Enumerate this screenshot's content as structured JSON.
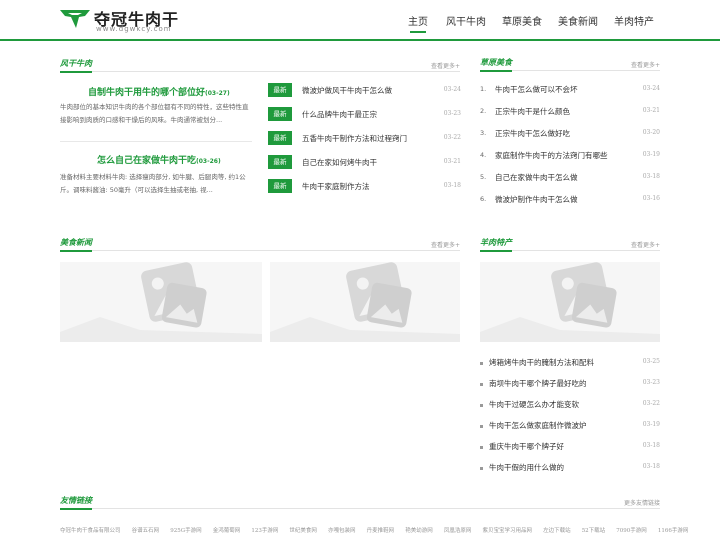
{
  "header": {
    "logo_title": "夺冠牛肉干",
    "logo_sub": "www.dgwkcy.com",
    "nav": [
      "主页",
      "风干牛肉",
      "草原美食",
      "美食新闻",
      "羊肉特产"
    ]
  },
  "sections": {
    "s1_title": "风干牛肉",
    "s1_more": "查看更多+",
    "s2_title": "草原美食",
    "s2_more": "查看更多+",
    "s3_title": "美食新闻",
    "s3_more": "查看更多+",
    "s4_title": "羊肉特产",
    "s4_more": "查看更多+",
    "s5_title": "友情链接",
    "s5_more": "更多友情链接"
  },
  "featured": [
    {
      "title": "自制牛肉干用牛的哪个部位好",
      "date": "(03-27)",
      "desc": "牛肉部位的基本知识牛肉的各个部位都有不同的特性，这些特性直接影响到肉质的口感和干燥后的风味。牛肉通常被划分..."
    },
    {
      "title": "怎么自己在家做牛肉干吃",
      "date": "(03-26)",
      "desc": "准备材料主要材料牛肉: 选择瘦肉部分, 如牛腱、后腿肉等, 约1公斤。调味料酱油: 50毫升（可以选择生抽或老抽, 视..."
    }
  ],
  "badge_label": "最新",
  "latest": [
    {
      "title": "微波炉做风干牛肉干怎么做",
      "date": "03-24"
    },
    {
      "title": "什么品牌牛肉干最正宗",
      "date": "03-23"
    },
    {
      "title": "五香牛肉干制作方法和过程窍门",
      "date": "03-22"
    },
    {
      "title": "自己在家如何烤牛肉干",
      "date": "03-21"
    },
    {
      "title": "牛肉干家庭制作方法",
      "date": "03-18"
    }
  ],
  "grassland": [
    {
      "num": "1.",
      "title": "牛肉干怎么做可以不会坏",
      "date": "03-24"
    },
    {
      "num": "2.",
      "title": "正宗牛肉干是什么颜色",
      "date": "03-21"
    },
    {
      "num": "3.",
      "title": "正宗牛肉干怎么做好吃",
      "date": "03-20"
    },
    {
      "num": "4.",
      "title": "家庭制作牛肉干的方法窍门有哪些",
      "date": "03-19"
    },
    {
      "num": "5.",
      "title": "自己在家做牛肉干怎么做",
      "date": "03-18"
    },
    {
      "num": "6.",
      "title": "微波炉制作牛肉干怎么做",
      "date": "03-16"
    }
  ],
  "specialty": [
    {
      "title": "烤箱烤牛肉干的腌制方法和配料",
      "date": "03-25"
    },
    {
      "title": "南坝牛肉干哪个牌子最好吃的",
      "date": "03-23"
    },
    {
      "title": "牛肉干过硬怎么办才能变软",
      "date": "03-22"
    },
    {
      "title": "牛肉干怎么做家庭制作微波炉",
      "date": "03-19"
    },
    {
      "title": "重庆牛肉干哪个牌子好",
      "date": "03-18"
    },
    {
      "title": "牛肉干假的用什么做的",
      "date": "03-18"
    }
  ],
  "links": [
    "夺冠牛肉干食品有限公司",
    "谷谱五石网",
    "925G手游网",
    "金鸿葡萄网",
    "123手游网",
    "世纪美食网",
    "亦嘎包装网",
    "丹麦推鞋网",
    "艳美幼游网",
    "凤凰浩原网",
    "紫贝宝宝学习用品网",
    "左边下载站",
    "52下载站",
    "7090手游网",
    "1166手游网"
  ],
  "colors": {
    "accent": "#1f9a3c"
  }
}
